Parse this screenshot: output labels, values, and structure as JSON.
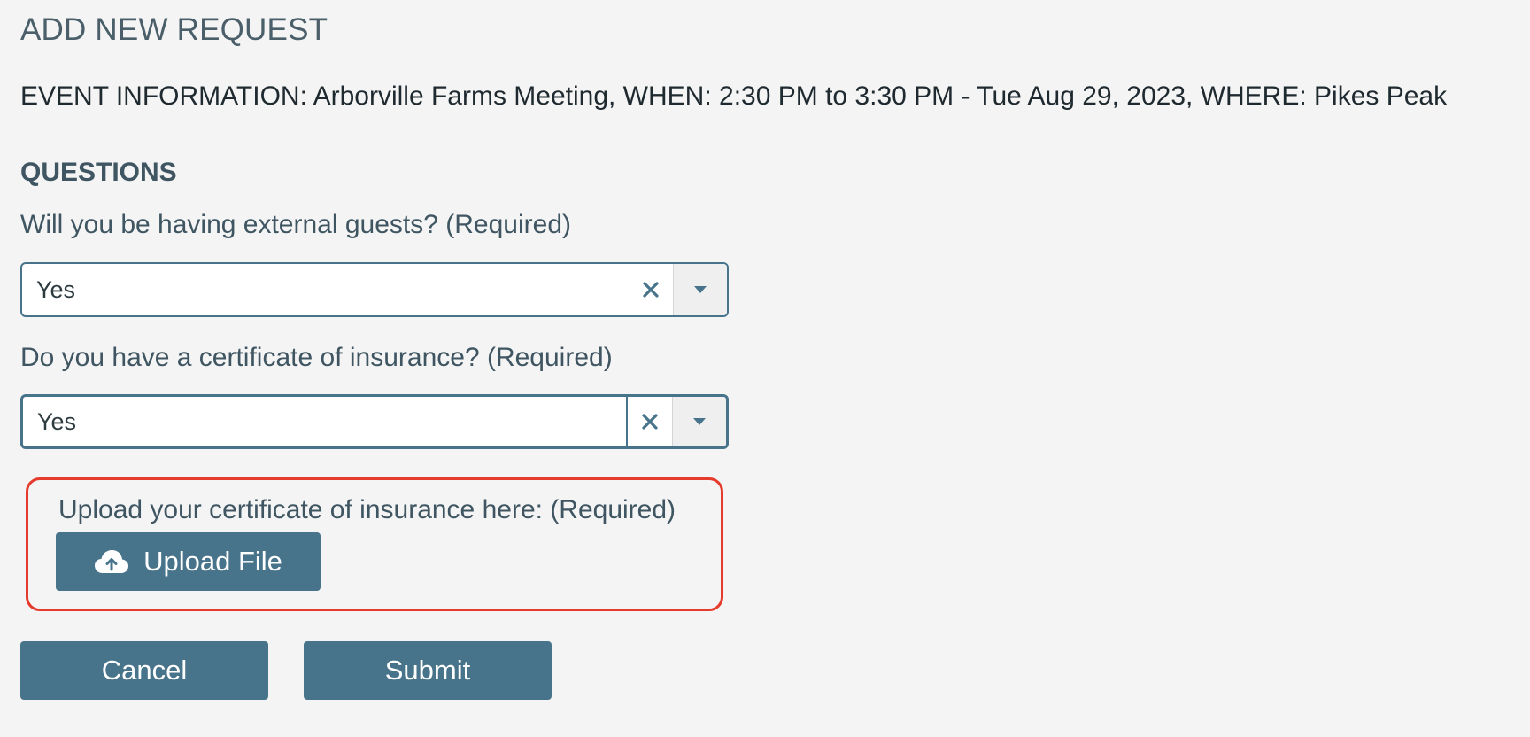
{
  "page": {
    "title": "ADD NEW REQUEST",
    "event_info": "EVENT INFORMATION: Arborville Farms Meeting, WHEN: 2:30 PM to 3:30 PM - Tue Aug 29, 2023, WHERE: Pikes Peak"
  },
  "questions": {
    "section_title": "QUESTIONS",
    "items": [
      {
        "label": "Will you be having external guests? (Required)",
        "value": "Yes",
        "icons": {
          "clear": "close-icon",
          "toggle": "caret-down-icon"
        }
      },
      {
        "label": "Do you have a certificate of insurance? (Required)",
        "value": "Yes",
        "icons": {
          "clear": "close-icon",
          "toggle": "caret-down-icon"
        }
      }
    ]
  },
  "upload": {
    "label": "Upload your certificate of insurance here: (Required)",
    "button_label": "Upload File",
    "icon": "cloud-upload-icon",
    "highlight_color": "#e43b2c"
  },
  "actions": {
    "cancel_label": "Cancel",
    "submit_label": "Submit"
  },
  "colors": {
    "accent": "#47748a",
    "background": "#f4f4f4",
    "text": "#3f5662"
  }
}
